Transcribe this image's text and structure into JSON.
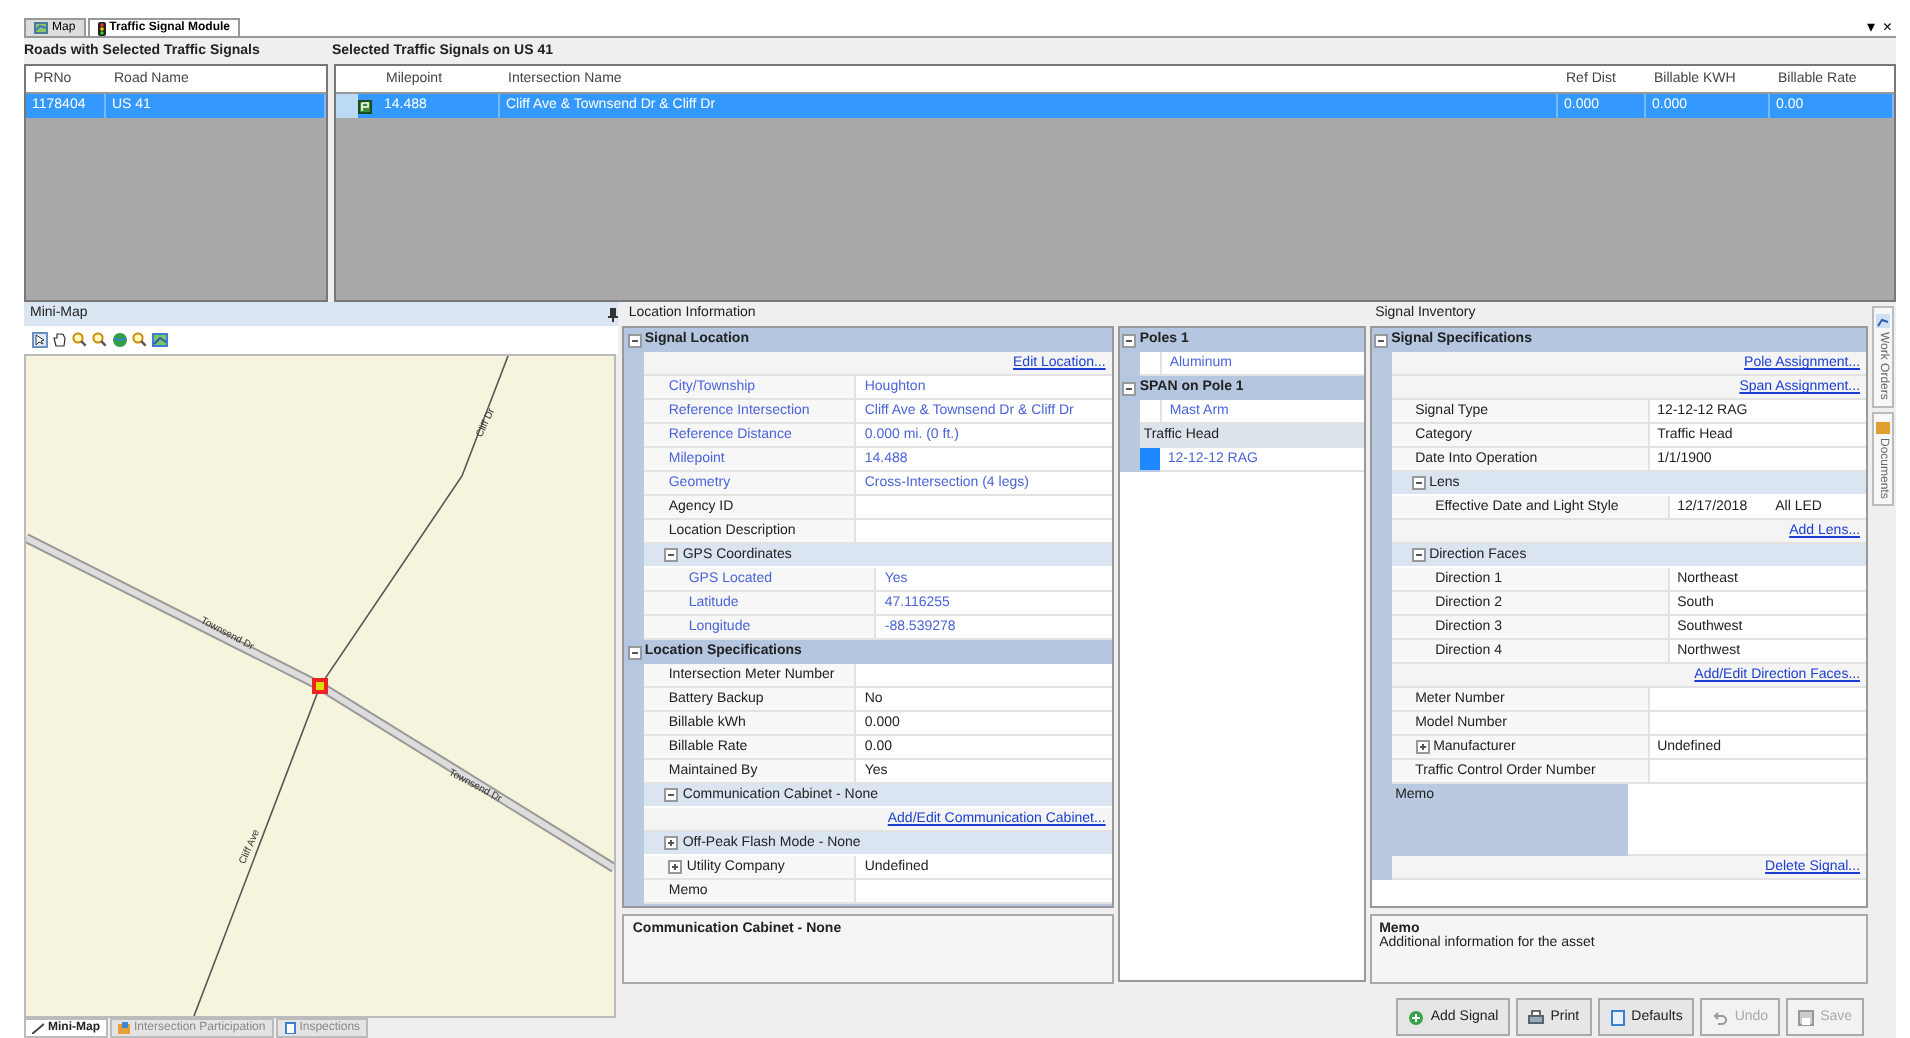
{
  "tabs": [
    {
      "label": "Map",
      "selected": false
    },
    {
      "label": "Traffic Signal Module",
      "selected": true
    }
  ],
  "window_controls": [
    "▾",
    "×"
  ],
  "roads": {
    "title": "Roads with Selected Traffic Signals",
    "columns": [
      "PRNo",
      "Road Name"
    ],
    "rows": [
      {
        "cells": [
          "1178404",
          "US 41"
        ],
        "selected": true
      }
    ]
  },
  "signals": {
    "title": "Selected Traffic Signals on US 41",
    "columns": [
      "Milepoint",
      "Intersection Name",
      "Ref Dist",
      "Billable KWH",
      "Billable Rate"
    ],
    "rows": [
      {
        "cells": [
          "14.488",
          "Cliff Ave & Townsend Dr & Cliff Dr",
          "0.000",
          "0.000",
          "0.00"
        ],
        "selected": true
      }
    ]
  },
  "mini_map": {
    "title": "Mini-Map",
    "road_labels": [
      "Cliff Dr",
      "Townsend Dr",
      "Townsend Dr",
      "Cliff Ave"
    ],
    "tabs": [
      {
        "label": "Mini-Map",
        "selected": true
      },
      {
        "label": "Intersection Participation",
        "selected": false
      },
      {
        "label": "Inspections",
        "selected": false
      }
    ]
  },
  "location_information": {
    "title": "Location Information",
    "items": [
      {
        "kind": "category",
        "label": "Signal Location",
        "expanded": true,
        "children": [
          {
            "kind": "link",
            "label": "Edit Location..."
          },
          {
            "kind": "property",
            "label": "City/Township",
            "value": "Houghton",
            "readonly": true
          },
          {
            "kind": "property",
            "label": "Reference Intersection",
            "value": "Cliff Ave & Townsend Dr & Cliff Dr",
            "readonly": true
          },
          {
            "kind": "property",
            "label": "Reference Distance",
            "value": "0.000 mi. (0 ft.)",
            "readonly": true
          },
          {
            "kind": "property",
            "label": "Milepoint",
            "value": "14.488",
            "readonly": true
          },
          {
            "kind": "property",
            "label": "Geometry",
            "value": "Cross-Intersection (4 legs)",
            "readonly": true
          },
          {
            "kind": "property",
            "label": "Agency ID",
            "readonly": false
          },
          {
            "kind": "property",
            "label": "Location Description",
            "readonly": false
          },
          {
            "kind": "group",
            "label": "GPS Coordinates",
            "expanded": true,
            "children": [
              {
                "kind": "property",
                "label": "GPS Located",
                "value": "Yes",
                "readonly": true
              },
              {
                "kind": "property",
                "label": "Latitude",
                "value": "47.116255",
                "readonly": true
              },
              {
                "kind": "property",
                "label": "Longitude",
                "value": "-88.539278",
                "readonly": true
              }
            ]
          }
        ]
      },
      {
        "kind": "category",
        "label": "Location Specifications",
        "expanded": true,
        "children": [
          {
            "kind": "property",
            "label": "Intersection Meter Number",
            "readonly": false
          },
          {
            "kind": "property",
            "label": "Battery Backup",
            "value": "No",
            "readonly": false
          },
          {
            "kind": "property",
            "label": "Billable kWh",
            "value": "0.000",
            "readonly": false
          },
          {
            "kind": "property",
            "label": "Billable Rate",
            "value": "0.00",
            "readonly": false
          },
          {
            "kind": "property",
            "label": "Maintained By",
            "value": "Yes",
            "readonly": false
          },
          {
            "kind": "group",
            "label": "Communication Cabinet - None",
            "expanded": true,
            "children": [
              {
                "kind": "link",
                "label": "Add/Edit Communication Cabinet..."
              }
            ]
          },
          {
            "kind": "group",
            "label": "Off-Peak Flash Mode - None",
            "expanded": false
          },
          {
            "kind": "property",
            "label": "Utility Company",
            "value": "Undefined",
            "readonly": false,
            "expanded": false
          },
          {
            "kind": "property",
            "label": "Memo",
            "readonly": false
          }
        ]
      }
    ],
    "description": {
      "title": "Communication Cabinet - None"
    }
  },
  "poles": {
    "items": [
      {
        "kind": "category",
        "label": "Poles 1",
        "expanded": true,
        "children": [
          {
            "kind": "property",
            "value": "Aluminum",
            "readonly": true
          }
        ]
      },
      {
        "kind": "category",
        "label": "SPAN on Pole 1",
        "expanded": true,
        "children": [
          {
            "kind": "property",
            "value": "Mast Arm",
            "readonly": true
          },
          {
            "kind": "header",
            "label": "Traffic Head"
          },
          {
            "kind": "swatch",
            "value": "12-12-12 RAG",
            "color": "#1e88ff"
          }
        ]
      }
    ]
  },
  "signal_inventory": {
    "title": "Signal Inventory",
    "items": [
      {
        "kind": "category",
        "label": "Signal Specifications",
        "expanded": true,
        "children": [
          {
            "kind": "link",
            "label": "Pole Assignment..."
          },
          {
            "kind": "link",
            "label": "Span Assignment..."
          },
          {
            "kind": "property",
            "label": "Signal Type",
            "value": "12-12-12 RAG",
            "readonly": false
          },
          {
            "kind": "property",
            "label": "Category",
            "value": "Traffic Head",
            "readonly": false
          },
          {
            "kind": "property",
            "label": "Date Into Operation",
            "value": "1/1/1900",
            "readonly": false
          },
          {
            "kind": "group",
            "label": "Lens",
            "expanded": true,
            "children": [
              {
                "kind": "property",
                "label": "Effective Date and Light Style",
                "value": "12/17/2018",
                "value_2": "All LED",
                "readonly": false
              }
            ]
          },
          {
            "kind": "link",
            "label": "Add Lens..."
          },
          {
            "kind": "group",
            "label": "Direction Faces",
            "expanded": true,
            "children": [
              {
                "kind": "property",
                "label": "Direction 1",
                "value": "Northeast",
                "readonly": false
              },
              {
                "kind": "property",
                "label": "Direction 2",
                "value": "South",
                "readonly": false
              },
              {
                "kind": "property",
                "label": "Direction 3",
                "value": "Southwest",
                "readonly": false
              },
              {
                "kind": "property",
                "label": "Direction 4",
                "value": "Northwest",
                "readonly": false
              }
            ]
          },
          {
            "kind": "link",
            "label": "Add/Edit Direction Faces..."
          },
          {
            "kind": "property",
            "label": "Meter Number",
            "readonly": false
          },
          {
            "kind": "property",
            "label": "Model Number",
            "readonly": false
          },
          {
            "kind": "property",
            "label": "Manufacturer",
            "value": "Undefined",
            "readonly": false,
            "expanded": false
          },
          {
            "kind": "property",
            "label": "Traffic Control Order Number",
            "readonly": false
          },
          {
            "kind": "memo",
            "label": "Memo"
          },
          {
            "kind": "link",
            "label": "Delete Signal..."
          }
        ]
      }
    ],
    "description": {
      "title": "Memo",
      "text": "Additional information for the asset"
    },
    "buttons": [
      {
        "label": "Add Signal",
        "kind": "add",
        "disabled": false
      },
      {
        "label": "Print",
        "kind": "print",
        "disabled": false
      },
      {
        "label": "Defaults",
        "kind": "defaults",
        "disabled": false
      },
      {
        "label": "Undo",
        "kind": "undo",
        "disabled": true
      },
      {
        "label": "Save",
        "kind": "save",
        "disabled": true
      }
    ]
  },
  "side_tabs": [
    {
      "label": "Work Orders"
    },
    {
      "label": "Documents"
    }
  ]
}
